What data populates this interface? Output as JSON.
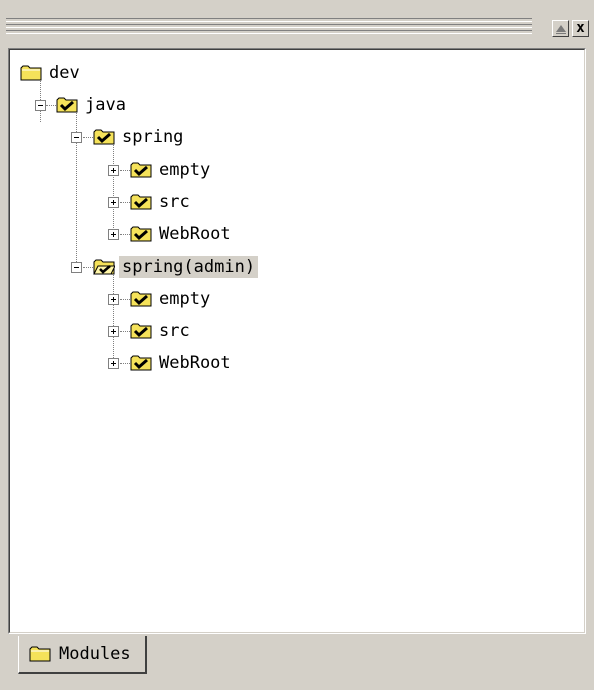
{
  "window": {
    "minimize_icon": "minimize-icon",
    "close_icon": "close-icon",
    "close_glyph": "x"
  },
  "tree": {
    "nodes": [
      {
        "label": "dev",
        "icon": "folder-icon"
      },
      {
        "label": "java",
        "icon": "folder-check-icon"
      },
      {
        "label": "spring",
        "icon": "folder-check-icon"
      },
      {
        "label": "empty",
        "icon": "folder-check-icon"
      },
      {
        "label": "src",
        "icon": "folder-check-icon"
      },
      {
        "label": "WebRoot",
        "icon": "folder-check-icon"
      },
      {
        "label": "spring(admin)",
        "icon": "folder-open-check-icon",
        "selected": true
      },
      {
        "label": "empty",
        "icon": "folder-check-icon"
      },
      {
        "label": "src",
        "icon": "folder-check-icon"
      },
      {
        "label": "WebRoot",
        "icon": "folder-check-icon"
      }
    ]
  },
  "tabs": {
    "modules_label": "Modules"
  },
  "colors": {
    "folder": "#f5e25a",
    "check": "#000000",
    "panel_bg": "#d4d0c8",
    "tree_bg": "#ffffff"
  }
}
